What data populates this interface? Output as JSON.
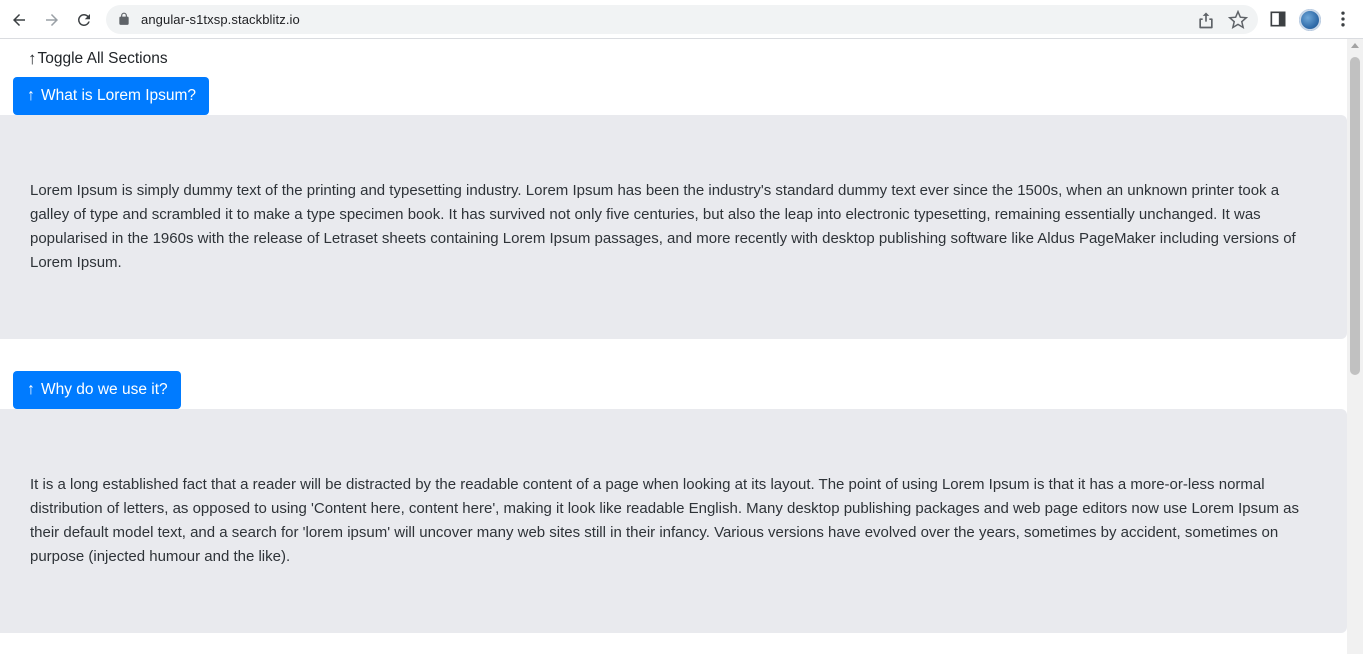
{
  "browser": {
    "url": "angular-s1txsp.stackblitz.io",
    "icons": [
      "back-arrow-icon",
      "forward-arrow-icon",
      "reload-icon",
      "lock-icon",
      "share-icon",
      "star-icon",
      "side-panel-icon",
      "profile-avatar",
      "menu-kebab-icon"
    ]
  },
  "page": {
    "toggle_all": {
      "arrow": "↑",
      "label": "Toggle All Sections"
    },
    "sections": [
      {
        "arrow": "↑",
        "title": "What is Lorem Ipsum?",
        "body": "Lorem Ipsum is simply dummy text of the printing and typesetting industry. Lorem Ipsum has been the industry's standard dummy text ever since the 1500s, when an unknown printer took a galley of type and scrambled it to make a type specimen book. It has survived not only five centuries, but also the leap into electronic typesetting, remaining essentially unchanged. It was popularised in the 1960s with the release of Letraset sheets containing Lorem Ipsum passages, and more recently with desktop publishing software like Aldus PageMaker including versions of Lorem Ipsum."
      },
      {
        "arrow": "↑",
        "title": "Why do we use it?",
        "body": "It is a long established fact that a reader will be distracted by the readable content of a page when looking at its layout. The point of using Lorem Ipsum is that it has a more-or-less normal distribution of letters, as opposed to using 'Content here, content here', making it look like readable English. Many desktop publishing packages and web page editors now use Lorem Ipsum as their default model text, and a search for 'lorem ipsum' will uncover many web sites still in their infancy. Various versions have evolved over the years, sometimes by accident, sometimes on purpose (injected humour and the like)."
      }
    ]
  },
  "colors": {
    "button_bg": "#007bff",
    "panel_bg": "#e9eaee",
    "body_text": "#2e3338"
  }
}
